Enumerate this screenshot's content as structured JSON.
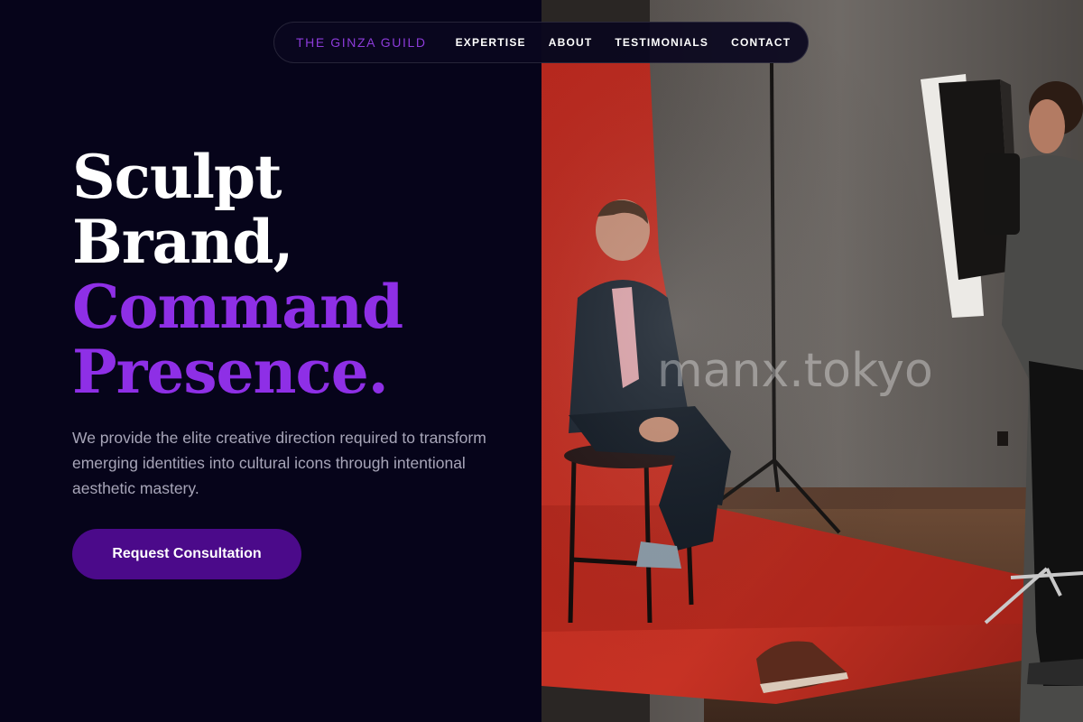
{
  "nav": {
    "brand": "THE GINZA GUILD",
    "links": [
      "EXPERTISE",
      "ABOUT",
      "TESTIMONIALS",
      "CONTACT"
    ]
  },
  "hero": {
    "headline_lines": [
      "Sculpt",
      "Brand,",
      "Command",
      "Presence."
    ],
    "subtext": "We provide the elite creative direction required to transform emerging identities into cultural icons through intentional aesthetic mastery.",
    "cta_label": "Request Consultation"
  },
  "photo": {
    "watermark": "manx.tokyo"
  },
  "colors": {
    "background": "#06041a",
    "accent_purple": "#8e2fe6",
    "brand_purple": "#8c3bd9",
    "cta_background": "#4b0a8a",
    "backdrop_red": "#c8281c"
  }
}
